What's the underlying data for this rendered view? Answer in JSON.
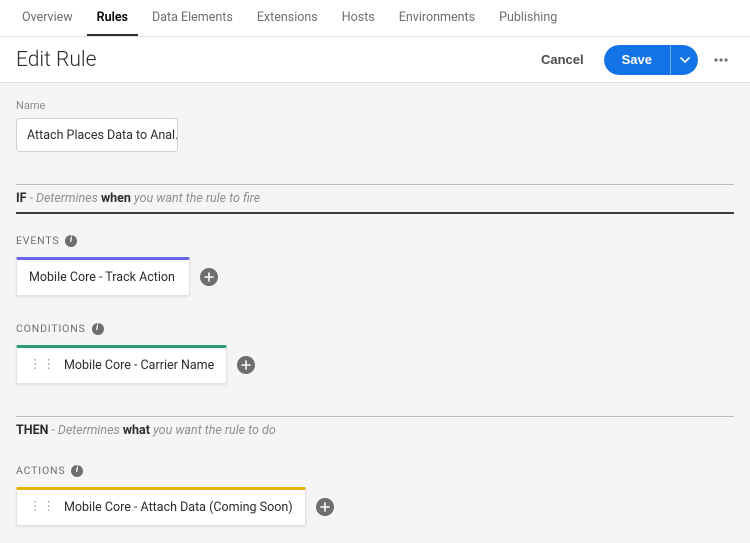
{
  "nav": {
    "items": [
      {
        "label": "Overview",
        "active": false
      },
      {
        "label": "Rules",
        "active": true
      },
      {
        "label": "Data Elements",
        "active": false
      },
      {
        "label": "Extensions",
        "active": false
      },
      {
        "label": "Hosts",
        "active": false
      },
      {
        "label": "Environments",
        "active": false
      },
      {
        "label": "Publishing",
        "active": false
      }
    ]
  },
  "header": {
    "title": "Edit Rule",
    "cancel": "Cancel",
    "save": "Save"
  },
  "name_field": {
    "label": "Name",
    "value": "Attach Places Data to Anal…"
  },
  "if_section": {
    "prefix": "IF",
    "middle": " - Determines ",
    "kw": "when",
    "suffix": " you want the rule to fire"
  },
  "events": {
    "heading": "EVENTS",
    "card": "Mobile Core - Track Action"
  },
  "conditions": {
    "heading": "CONDITIONS",
    "card": "Mobile Core - Carrier Name"
  },
  "then_section": {
    "prefix": "THEN",
    "middle": " - Determines ",
    "kw": "what",
    "suffix": " you want the rule to do"
  },
  "actions": {
    "heading": "ACTIONS",
    "card": "Mobile Core - Attach Data (Coming Soon)"
  },
  "colors": {
    "events": "#6767ec",
    "conditions": "#2d9d78",
    "actions": "#e2b500",
    "primary": "#1473e6"
  }
}
